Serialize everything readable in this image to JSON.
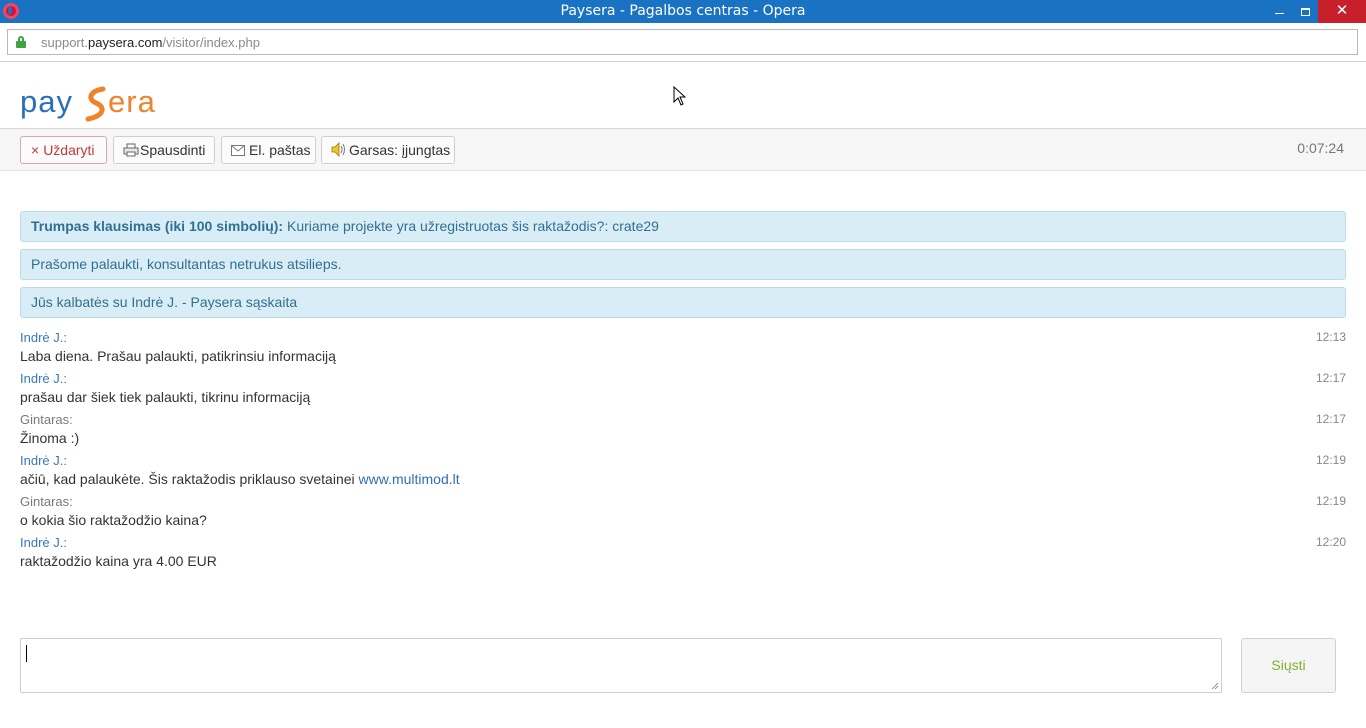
{
  "window": {
    "title": "Paysera - Pagalbos centras - Opera",
    "minimize_icon": "minimize-icon",
    "maximize_icon": "restore-icon",
    "close_glyph": "✕"
  },
  "address": {
    "url_prefix": "support.",
    "url_domain": "paysera.com",
    "url_path": "/visitor/index.php",
    "secure_icon": "lock-icon"
  },
  "brand": {
    "logo_text": "paysera",
    "colors": {
      "blue": "#2a70b8",
      "orange": "#f0822a"
    }
  },
  "toolbar": {
    "close_label": "Uždaryti",
    "close_glyph": "×",
    "print_label": "Spausdinti",
    "email_label": "El. paštas",
    "sound_label": "Garsas: įjungtas",
    "timer": "0:07:24"
  },
  "info": {
    "question_label": "Trumpas klausimas (iki 100 simbolių):",
    "question_text": " Kuriame projekte yra užregistruotas šis raktažodis?: crate29",
    "waiting": "Prašome palaukti, konsultantas netrukus atsilieps.",
    "connected": "Jūs kalbatės su Indrė J. - Paysera sąskaita"
  },
  "messages": [
    {
      "author": "Indrė J.:",
      "time": "12:13",
      "text": "Laba diena. Prašau palaukti, patikrinsiu informaciją"
    },
    {
      "author": "Indrė J.:",
      "time": "12:17",
      "text": "prašau dar šiek tiek palaukti, tikrinu informaciją"
    },
    {
      "author": "Gintaras:",
      "time": "12:17",
      "text": "Žinoma :)"
    },
    {
      "author": "Indrė J.:",
      "time": "12:19",
      "text": "ačiū, kad palaukėte. Šis raktažodis priklauso svetainei ",
      "link": "www.multimod.lt"
    },
    {
      "author": "Gintaras:",
      "time": "12:19",
      "text": "o kokia šio raktažodžio kaina?"
    },
    {
      "author": "Indrė J.:",
      "time": "12:20",
      "text": "raktažodžio kaina yra 4.00 EUR"
    }
  ],
  "composer": {
    "value": "",
    "send_label": "Siųsti"
  }
}
